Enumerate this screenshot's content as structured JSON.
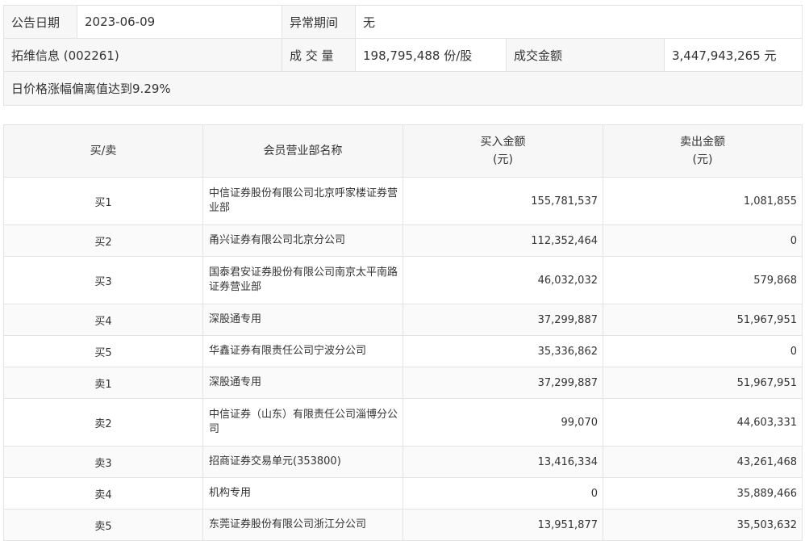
{
  "summary": {
    "announce_label": "公告日期",
    "announce_value": "2023-06-09",
    "abnormal_label": "异常期间",
    "abnormal_value": "无",
    "stock_label": "拓维信息 (002261)",
    "volume_label": "成 交 量",
    "volume_value": "198,795,488 份/股",
    "amount_label": "成交金额",
    "amount_value": "3,447,943,265 元",
    "reason": "日价格涨幅偏离值达到9.29%"
  },
  "table": {
    "headers": {
      "side": "买/卖",
      "member": "会员营业部名称",
      "buy_line1": "买入金额",
      "buy_line2": "(元)",
      "sell_line1": "卖出金额",
      "sell_line2": "(元)"
    },
    "rows": [
      {
        "side": "买1",
        "member": "中信证券股份有限公司北京呼家楼证券营业部",
        "buy": "155,781,537",
        "sell": "1,081,855"
      },
      {
        "side": "买2",
        "member": "甬兴证券有限公司北京分公司",
        "buy": "112,352,464",
        "sell": "0"
      },
      {
        "side": "买3",
        "member": "国泰君安证券股份有限公司南京太平南路证券营业部",
        "buy": "46,032,032",
        "sell": "579,868"
      },
      {
        "side": "买4",
        "member": "深股通专用",
        "buy": "37,299,887",
        "sell": "51,967,951"
      },
      {
        "side": "买5",
        "member": "华鑫证券有限责任公司宁波分公司",
        "buy": "35,336,862",
        "sell": "0"
      },
      {
        "side": "卖1",
        "member": "深股通专用",
        "buy": "37,299,887",
        "sell": "51,967,951"
      },
      {
        "side": "卖2",
        "member": "中信证券（山东）有限责任公司淄博分公司",
        "buy": "99,070",
        "sell": "44,603,331"
      },
      {
        "side": "卖3",
        "member": "招商证券交易单元(353800)",
        "buy": "13,416,334",
        "sell": "43,261,468"
      },
      {
        "side": "卖4",
        "member": "机构专用",
        "buy": "0",
        "sell": "35,889,466"
      },
      {
        "side": "卖5",
        "member": "东莞证券股份有限公司浙江分公司",
        "buy": "13,951,877",
        "sell": "35,503,632"
      }
    ]
  }
}
